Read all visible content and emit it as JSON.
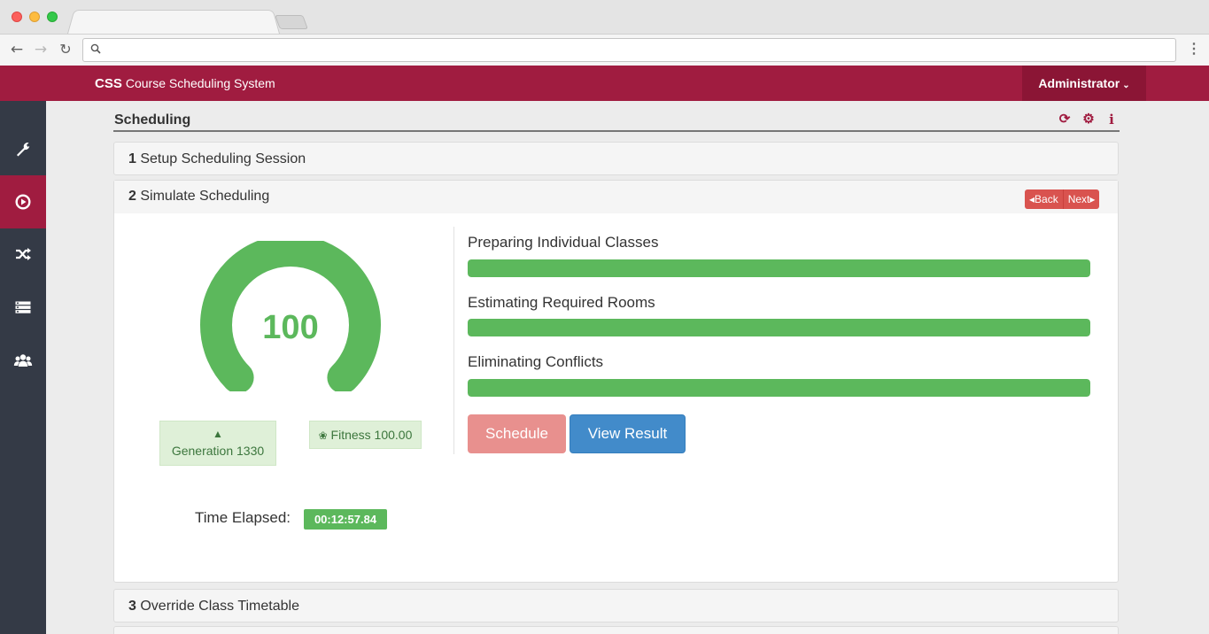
{
  "browser": {
    "url": ""
  },
  "header": {
    "brand_short": "CSS",
    "brand_full": "Course Scheduling System",
    "user_menu": "Administrator"
  },
  "sidebar": {
    "items": [
      {
        "icon": "wrench-icon",
        "active": false
      },
      {
        "icon": "play-circle-icon",
        "active": true
      },
      {
        "icon": "shuffle-icon",
        "active": false
      },
      {
        "icon": "list-icon",
        "active": false
      },
      {
        "icon": "users-icon",
        "active": false
      }
    ]
  },
  "page": {
    "title": "Scheduling",
    "actions": [
      "refresh-icon",
      "gear-icon",
      "info-icon"
    ]
  },
  "steps": [
    {
      "number": "1",
      "label": "Setup Scheduling Session"
    },
    {
      "number": "2",
      "label": "Simulate Scheduling"
    },
    {
      "number": "3",
      "label": "Override Class Timetable"
    }
  ],
  "simulate": {
    "back_label": "Back",
    "next_label": "Next",
    "gauge_value": "100",
    "gauge_fraction": 1.0,
    "generation_label": "Generation 1330",
    "fitness_label": "Fitness 100.00",
    "time_elapsed_label": "Time Elapsed:",
    "time_elapsed_value": "00:12:57.84",
    "progress": [
      {
        "label": "Preparing Individual Classes",
        "percent": 100
      },
      {
        "label": "Estimating Required Rooms",
        "percent": 100
      },
      {
        "label": "Eliminating Conflicts",
        "percent": 100
      }
    ],
    "schedule_button": "Schedule",
    "view_result_button": "View Result"
  },
  "colors": {
    "brand": "#a01c40",
    "success": "#5cb85c",
    "primary": "#428bca",
    "danger": "#d9534f"
  }
}
